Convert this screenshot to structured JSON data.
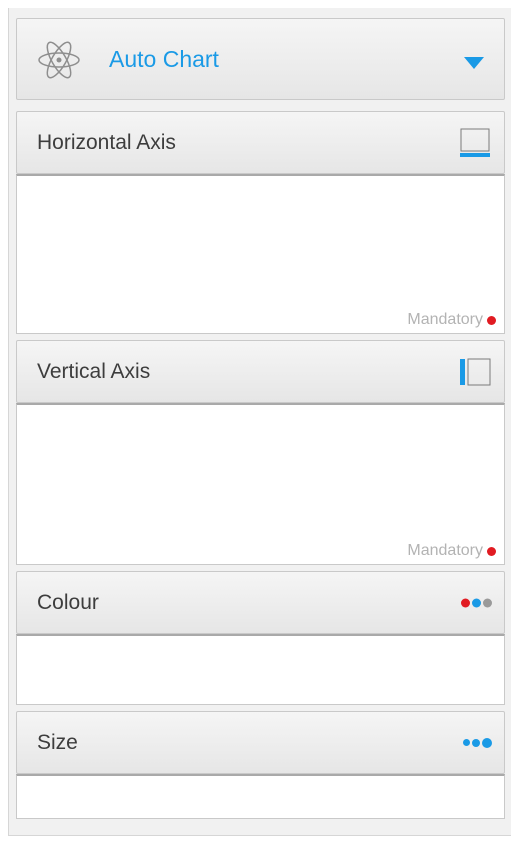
{
  "chart_type_selector": {
    "label": "Auto Chart",
    "icon": "atom-icon",
    "dropdown_icon": "caret-down-icon"
  },
  "sections": [
    {
      "key": "horizontal",
      "title": "Horizontal Axis",
      "icon": "horizontal-axis-icon",
      "mandatory_text": "Mandatory"
    },
    {
      "key": "vertical",
      "title": "Vertical Axis",
      "icon": "vertical-axis-icon",
      "mandatory_text": "Mandatory"
    },
    {
      "key": "colour",
      "title": "Colour",
      "icon": "colour-dots-icon"
    },
    {
      "key": "size",
      "title": "Size",
      "icon": "size-dots-icon"
    }
  ],
  "colors": {
    "accent": "#1a9ae6",
    "mandatory_dot": "#e11b22",
    "muted_dot": "#9a9a9a"
  }
}
